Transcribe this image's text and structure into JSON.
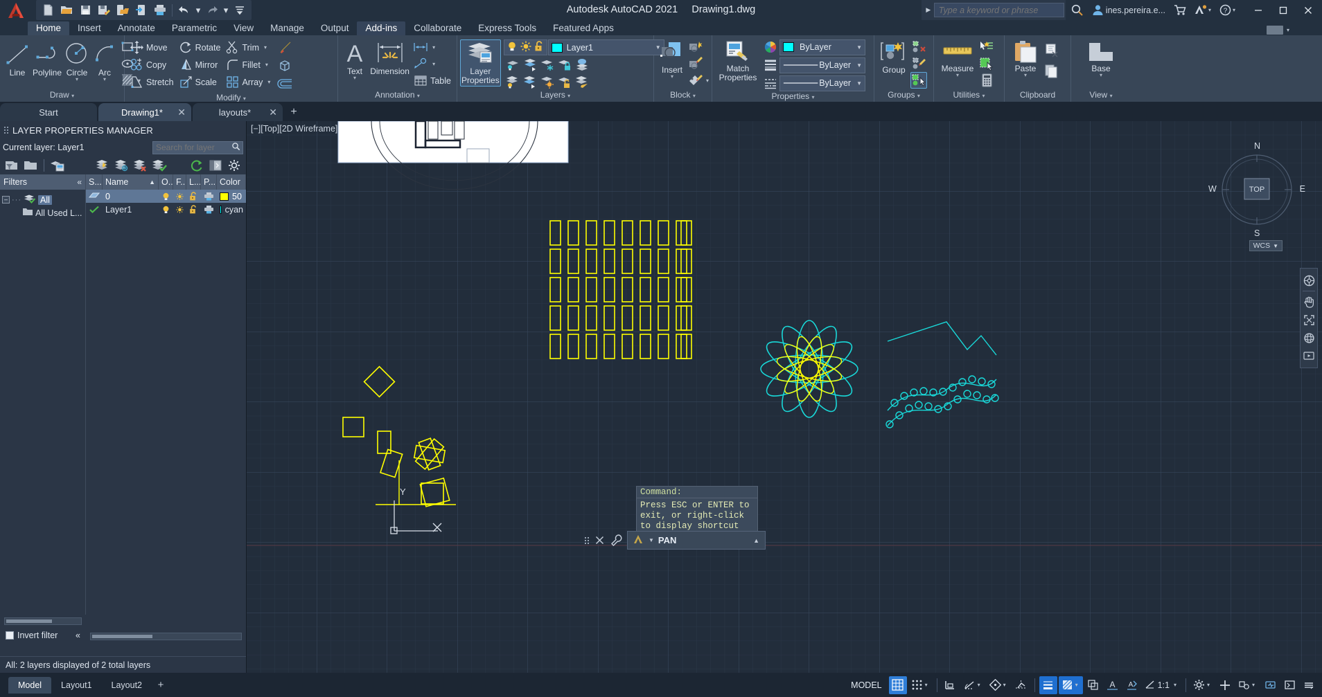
{
  "titlebar": {
    "app_title": "Autodesk AutoCAD 2021",
    "document_title": "Drawing1.dwg",
    "quick_access": [
      {
        "name": "new-icon",
        "tip": "New"
      },
      {
        "name": "open-icon",
        "tip": "Open"
      },
      {
        "name": "save-icon",
        "tip": "Save"
      },
      {
        "name": "save-as-icon",
        "tip": "Save As"
      },
      {
        "name": "open-from-web-icon",
        "tip": "Open from Web & Mobile"
      },
      {
        "name": "save-to-web-icon",
        "tip": "Save to Web & Mobile"
      },
      {
        "name": "plot-icon",
        "tip": "Plot"
      },
      {
        "name": "undo-icon",
        "tip": "Undo"
      },
      {
        "name": "redo-icon",
        "tip": "Redo"
      },
      {
        "name": "customize-icon",
        "tip": "Customize Quick Access Toolbar"
      }
    ],
    "search_placeholder": "Type a keyword or phrase",
    "user_name": "ines.pereira.e...",
    "window_buttons": [
      "minimize",
      "restore",
      "close"
    ]
  },
  "ribbon_tabs": [
    {
      "label": "Home",
      "state": "active"
    },
    {
      "label": "Insert",
      "state": "normal"
    },
    {
      "label": "Annotate",
      "state": "normal"
    },
    {
      "label": "Parametric",
      "state": "normal"
    },
    {
      "label": "View",
      "state": "normal"
    },
    {
      "label": "Manage",
      "state": "normal"
    },
    {
      "label": "Output",
      "state": "normal"
    },
    {
      "label": "Add-ins",
      "state": "selected"
    },
    {
      "label": "Collaborate",
      "state": "normal"
    },
    {
      "label": "Express Tools",
      "state": "normal"
    },
    {
      "label": "Featured Apps",
      "state": "normal"
    }
  ],
  "ribbon": {
    "draw": {
      "title": "Draw",
      "buttons": [
        {
          "label": "Line",
          "icon": "line-icon"
        },
        {
          "label": "Polyline",
          "icon": "polyline-icon"
        },
        {
          "label": "Circle",
          "icon": "circle-icon",
          "has_caret": true
        },
        {
          "label": "Arc",
          "icon": "arc-icon",
          "has_caret": true
        }
      ],
      "small": [
        {
          "icon": "rectangle-icon"
        },
        {
          "icon": "ellipse-icon"
        },
        {
          "icon": "hatch-icon"
        }
      ]
    },
    "modify": {
      "title": "Modify",
      "items": [
        {
          "label": "Move",
          "icon": "move-icon"
        },
        {
          "label": "Rotate",
          "icon": "rotate-icon"
        },
        {
          "label": "Trim",
          "icon": "trim-icon",
          "has_caret": true
        },
        {
          "label": "Copy",
          "icon": "copy-icon"
        },
        {
          "label": "Mirror",
          "icon": "mirror-icon"
        },
        {
          "label": "Fillet",
          "icon": "fillet-icon",
          "has_caret": true
        },
        {
          "label": "Stretch",
          "icon": "stretch-icon"
        },
        {
          "label": "Scale",
          "icon": "scale-icon"
        },
        {
          "label": "Array",
          "icon": "array-icon",
          "has_caret": true
        }
      ],
      "extras": [
        {
          "icon": "erase-icon"
        },
        {
          "icon": "3d-solid-icon"
        },
        {
          "icon": "offset-icon"
        }
      ]
    },
    "annotation": {
      "title": "Annotation",
      "buttons": [
        {
          "label": "Text",
          "icon": "text-icon",
          "has_caret": true
        },
        {
          "label": "Dimension",
          "icon": "dimension-icon"
        }
      ],
      "small": [
        {
          "icon": "linear-dim-icon",
          "has_caret": true
        },
        {
          "icon": "leader-icon",
          "has_caret": true
        },
        {
          "label": "Table",
          "icon": "table-icon"
        }
      ]
    },
    "layers": {
      "title": "Layers",
      "properties_button": {
        "label_line1": "Layer",
        "label_line2": "Properties",
        "icon": "layer-properties-icon",
        "active": true
      },
      "current_layer": "Layer1",
      "current_layer_color": "#00ffff",
      "state_icons": [
        "lightbulb-on-icon",
        "sun-icon",
        "unlock-icon"
      ],
      "tool_icons_row1": [
        "layer-isolate-icon",
        "layer-unisolate-icon",
        "layer-freeze-icon",
        "layer-lock-icon",
        "layer-on-icon"
      ],
      "tool_icons_row2": [
        "layer-off-icon",
        "layer-merge-icon",
        "layer-thaw-icon",
        "layer-unlock-icon",
        "layer-change-icon"
      ]
    },
    "block": {
      "title": "Block",
      "insert": {
        "label": "Insert",
        "icon": "insert-block-icon",
        "has_caret": true
      },
      "small": [
        {
          "icon": "create-block-icon"
        },
        {
          "icon": "edit-block-icon"
        },
        {
          "icon": "edit-attribute-icon",
          "has_caret": true
        }
      ]
    },
    "properties": {
      "title": "Properties",
      "match": {
        "label_line1": "Match",
        "label_line2": "Properties",
        "icon": "match-properties-icon"
      },
      "color": {
        "icon": "color-wheel-icon",
        "value": "ByLayer",
        "swatch": "#00ffff"
      },
      "linewidth": {
        "icon": "lineweight-icon",
        "value": "ByLayer"
      },
      "linetype": {
        "icon": "linetype-icon",
        "value": "ByLayer"
      }
    },
    "groups": {
      "title": "Groups",
      "group": {
        "label": "Group",
        "icon": "group-icon"
      },
      "small": [
        {
          "icon": "ungroup-icon"
        },
        {
          "icon": "group-edit-icon"
        },
        {
          "icon": "group-selection-icon",
          "active": true
        }
      ]
    },
    "utilities": {
      "title": "Utilities",
      "measure": {
        "label": "Measure",
        "icon": "measure-ruler-icon",
        "has_caret": true
      },
      "small": [
        {
          "icon": "quick-select-icon"
        },
        {
          "icon": "add-selected-icon"
        },
        {
          "icon": "calculator-icon"
        }
      ]
    },
    "clipboard": {
      "title": "Clipboard",
      "paste": {
        "label": "Paste",
        "icon": "paste-icon",
        "has_caret": true
      },
      "small": [
        {
          "icon": "cut-icon"
        },
        {
          "icon": "copy-clip-icon"
        }
      ]
    },
    "view": {
      "title": "View",
      "base": {
        "label": "Base",
        "icon": "base-view-icon",
        "has_caret": true
      }
    }
  },
  "document_tabs": [
    {
      "label": "Start",
      "active": false,
      "closable": false
    },
    {
      "label": "Drawing1*",
      "active": true,
      "closable": true
    },
    {
      "label": "layouts*",
      "active": false,
      "closable": true
    }
  ],
  "palette": {
    "title": "LAYER PROPERTIES MANAGER",
    "current_layer_label": "Current layer: Layer1",
    "search_placeholder": "Search for layer",
    "toolbar_icons": [
      "new-property-filter-icon",
      "new-group-filter-icon",
      "layer-states-manager-icon",
      "new-layer-icon",
      "new-layer-vp-frozen-icon",
      "delete-layer-icon",
      "set-current-icon",
      "refresh-icon",
      "settings-panel-icon",
      "settings-icon"
    ],
    "filters_header": "Filters",
    "filters_collapse": "«",
    "tree": [
      {
        "label": "All",
        "selected": true,
        "level": 0
      },
      {
        "label": "All Used L...",
        "selected": false,
        "level": 1
      }
    ],
    "columns": [
      "S...",
      "Name",
      "O..",
      "F...",
      "L...",
      "P...",
      "Color"
    ],
    "rows": [
      {
        "status": "layer-icon",
        "name": "0",
        "on": "lightbulb-on-icon",
        "freeze": "sun-icon",
        "lock": "unlock-icon",
        "plot": "plot-icon",
        "color": "50",
        "color_hex": "#ffff00",
        "selected": true
      },
      {
        "status": "current-check-icon",
        "name": "Layer1",
        "on": "lightbulb-on-icon",
        "freeze": "sun-icon",
        "lock": "unlock-icon",
        "plot": "plot-icon",
        "color": "cyan",
        "color_hex": "#00ffff",
        "selected": false
      }
    ],
    "invert_filter_label": "Invert filter",
    "invert_filter_checked": false,
    "status_text": "All: 2 layers displayed of 2 total layers"
  },
  "canvas": {
    "viewport_label": "[−][Top][2D Wireframe]",
    "command_prompt": "Command:",
    "command_hint": "Press ESC or ENTER to exit, or right-click to display shortcut menu.",
    "active_command": "PAN",
    "viewcube": {
      "top": "TOP",
      "n": "N",
      "s": "S",
      "e": "E",
      "w": "W"
    },
    "ucs_badge": "WCS",
    "nav_icons": [
      "steering-wheel-icon",
      "pan-hand-icon",
      "zoom-extents-icon",
      "orbit-icon",
      "showmotion-icon"
    ],
    "axis": {
      "x": "X",
      "y": "Y"
    }
  },
  "layout_tabs": [
    {
      "label": "Model",
      "active": true
    },
    {
      "label": "Layout1",
      "active": false
    },
    {
      "label": "Layout2",
      "active": false
    }
  ],
  "status_bar": {
    "model_label": "MODEL",
    "scale": "1:1",
    "buttons": [
      {
        "name": "grid-display",
        "icon": "grid-icon",
        "on": true
      },
      {
        "name": "snap-mode",
        "icon": "snap-icon",
        "on": false,
        "caret": true
      },
      {
        "name": "ortho-mode",
        "icon": "ortho-icon",
        "on": false
      },
      {
        "name": "polar-tracking",
        "icon": "polar-icon",
        "on": false,
        "caret": true
      },
      {
        "name": "object-snap",
        "icon": "osnap-icon",
        "on": false,
        "caret": true
      },
      {
        "name": "object-snap-tracking",
        "icon": "otrack-icon",
        "on": false
      },
      {
        "name": "lineweight",
        "icon": "lineweight-status-icon",
        "on": true
      },
      {
        "name": "transparency",
        "icon": "transparency-icon",
        "on": true,
        "caret": true
      },
      {
        "name": "selection-cycling",
        "icon": "selection-cycling-icon",
        "on": false
      },
      {
        "name": "annotation-visibility",
        "icon": "annotation-visibility-icon",
        "on": false
      },
      {
        "name": "autoscale",
        "icon": "autoscale-icon",
        "on": false
      },
      {
        "name": "annotation-scale",
        "icon": "scale-icon",
        "label": "1:1",
        "caret": true
      },
      {
        "name": "workspace-switching",
        "icon": "gear-icon",
        "on": false,
        "caret": true
      },
      {
        "name": "customization",
        "icon": "plus-icon",
        "on": false
      },
      {
        "name": "isolate-objects",
        "icon": "isolate-icon",
        "on": false,
        "caret": true
      },
      {
        "name": "hardware-acceleration",
        "icon": "graphics-icon",
        "on": false
      },
      {
        "name": "clean-screen",
        "icon": "clean-screen-icon",
        "on": false
      },
      {
        "name": "status-menu",
        "icon": "status-menu-icon",
        "on": false
      }
    ]
  },
  "colors": {
    "title_bg": "#23303f",
    "ribbon_bg": "#384657",
    "canvas_bg": "#222d3b",
    "palette_bg": "#2b3646",
    "accent_blue": "#2f7ed8",
    "yellow": "#ffff00",
    "cyan": "#00ffff",
    "highlight": "#5f7796"
  }
}
